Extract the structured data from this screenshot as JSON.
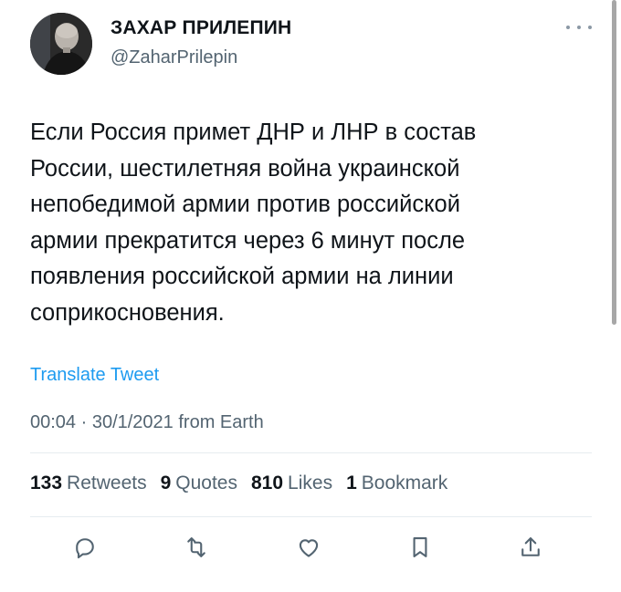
{
  "author": {
    "display_name": "ЗАХАР ПРИЛЕПИН",
    "handle": "@ZaharPrilepin"
  },
  "tweet": {
    "text_lines": [
      "Если Россия примет ДНР и ЛНР в состав",
      "России, шестилетняя война украинской",
      "непобедимой армии против российской",
      "армии прекратится через 6 минут после",
      "появления российской армии на линии",
      "соприкосновения."
    ],
    "translate_label": "Translate Tweet",
    "timestamp": "00:04 · 30/1/2021 from Earth"
  },
  "stats": {
    "retweets_count": "133",
    "retweets_label": "Retweets",
    "quotes_count": "9",
    "quotes_label": "Quotes",
    "likes_count": "810",
    "likes_label": "Likes",
    "bookmarks_count": "1",
    "bookmarks_label": "Bookmark"
  },
  "actions": [
    "reply-icon",
    "retweet-icon",
    "heart-icon",
    "bookmark-icon",
    "share-icon"
  ],
  "colors": {
    "link": "#1d9bf0",
    "secondary_text": "#536471",
    "primary_text": "#0f1419",
    "icon": "#536471"
  }
}
